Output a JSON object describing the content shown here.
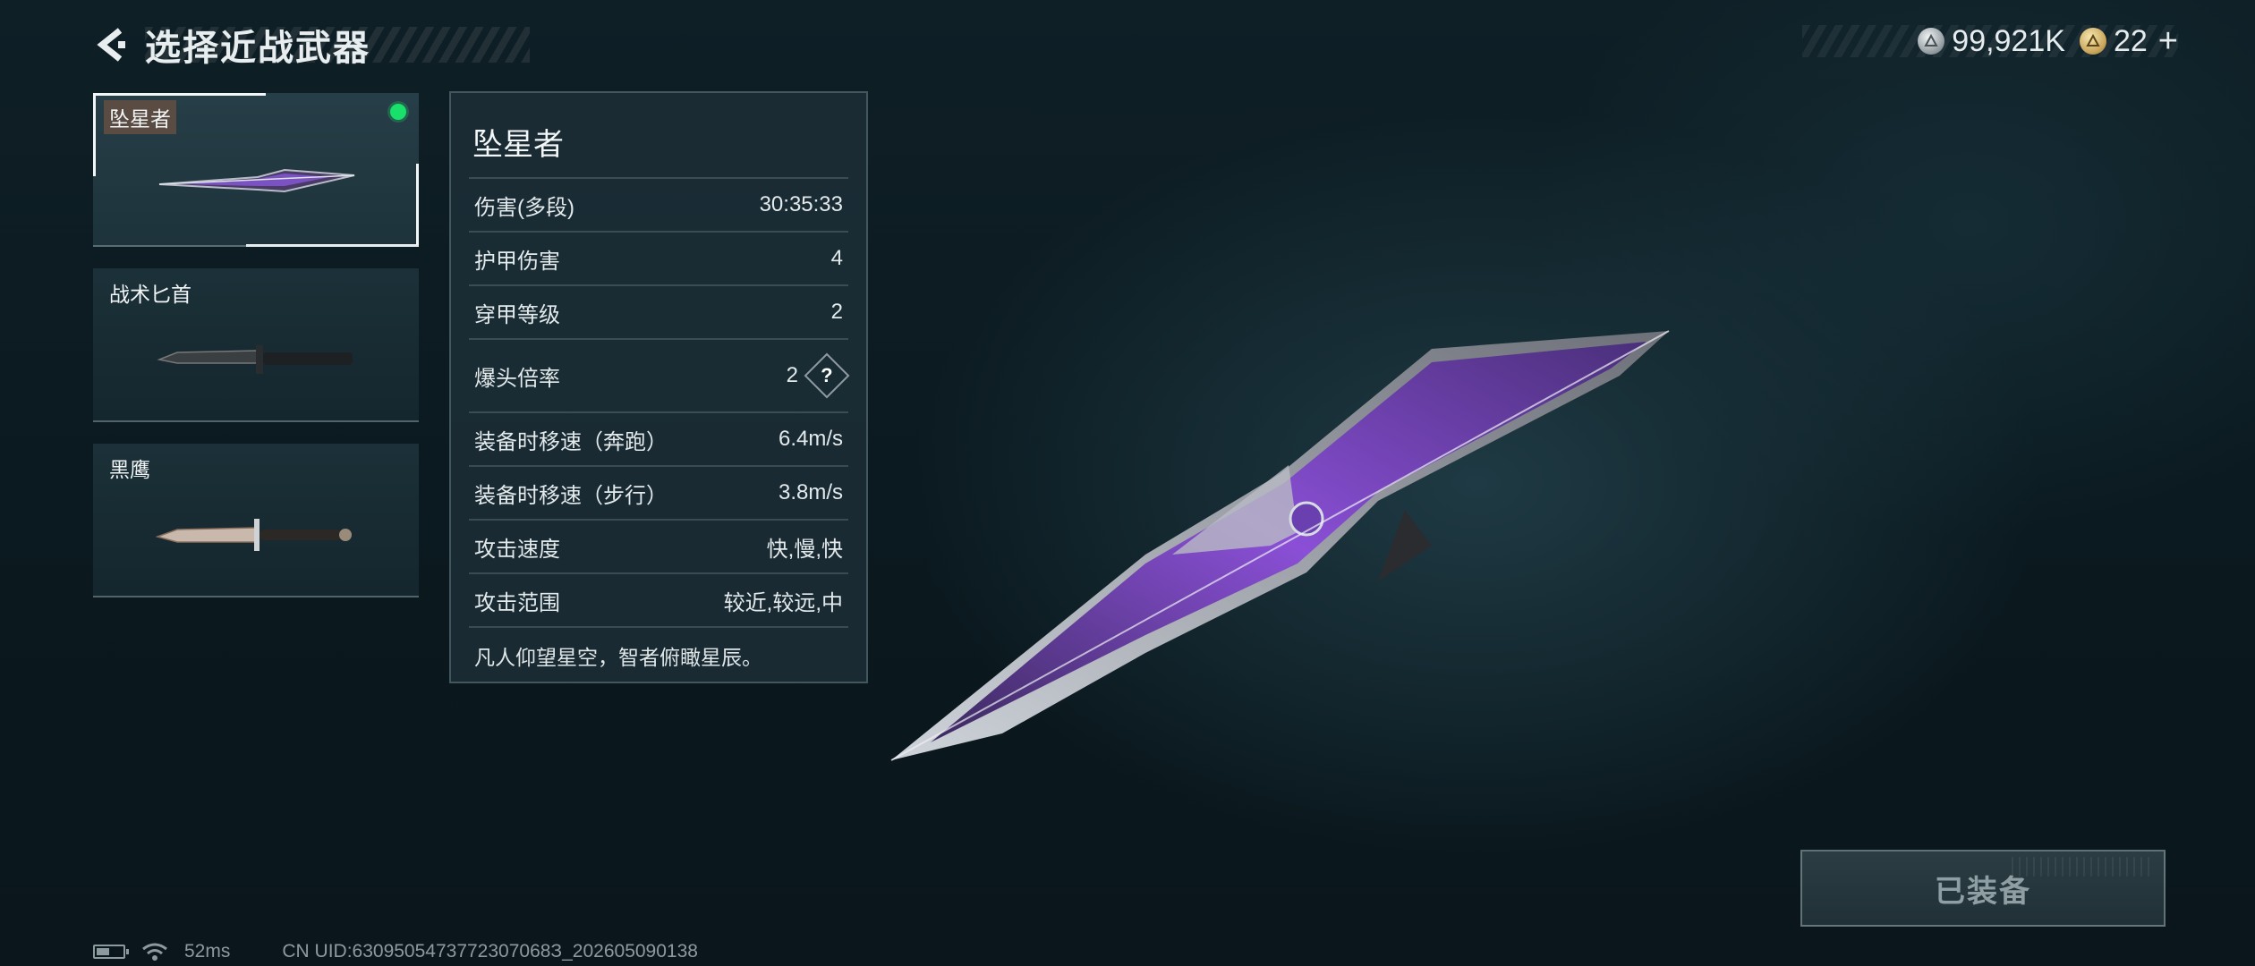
{
  "header": {
    "title": "选择近战武器"
  },
  "currency": {
    "silver": {
      "value": "99,921K",
      "icon": "silver-coin-icon"
    },
    "gold": {
      "value": "22",
      "icon": "gold-coin-icon",
      "add_label": "+"
    }
  },
  "weapons": [
    {
      "name": "坠星者",
      "selected": true,
      "equipped": true
    },
    {
      "name": "战术匕首",
      "selected": false,
      "equipped": false
    },
    {
      "name": "黑鹰",
      "selected": false,
      "equipped": false
    }
  ],
  "stats": {
    "name": "坠星者",
    "rows": [
      {
        "label": "伤害(多段)",
        "value": "30:35:33"
      },
      {
        "label": "护甲伤害",
        "value": "4"
      },
      {
        "label": "穿甲等级",
        "value": "2"
      },
      {
        "label": "爆头倍率",
        "value": "2",
        "help": "?"
      },
      {
        "label": "装备时移速（奔跑）",
        "value": "6.4m/s"
      },
      {
        "label": "装备时移速（步行）",
        "value": "3.8m/s"
      },
      {
        "label": "攻击速度",
        "value": "快,慢,快"
      },
      {
        "label": "攻击范围",
        "value": "较近,较远,中"
      }
    ],
    "description": "凡人仰望星空，智者俯瞰星辰。"
  },
  "equip_button": {
    "label": "已装备",
    "state": "disabled"
  },
  "footer": {
    "ping": "52ms",
    "uid": "CN UID:6309505473772307068З_202605090138"
  },
  "colors": {
    "equipped_dot": "#19e06a",
    "accent_purple": "#8a4fd6"
  }
}
